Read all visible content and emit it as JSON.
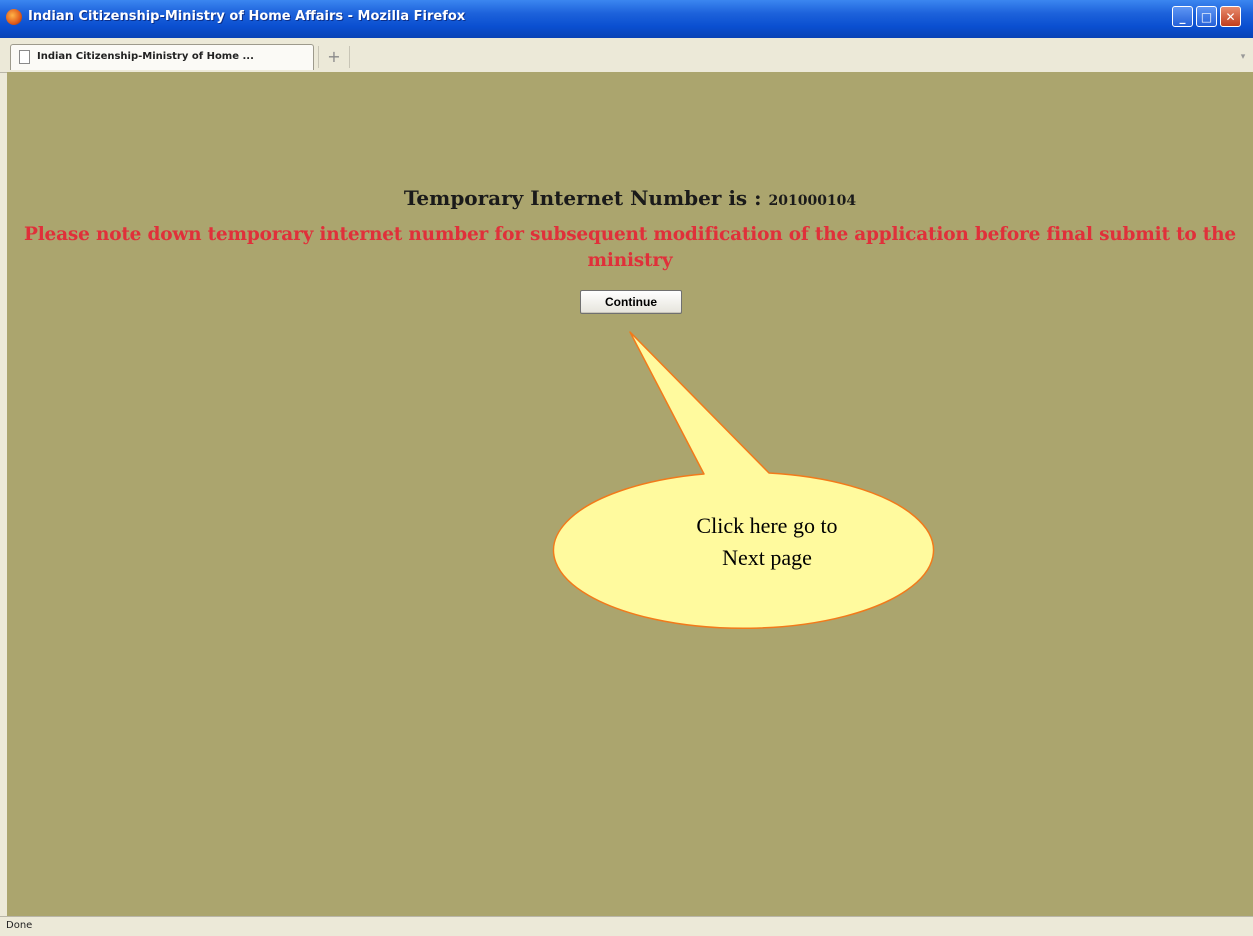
{
  "window": {
    "title": "Indian Citizenship-Ministry of Home Affairs - Mozilla Firefox",
    "min_symbol": "_",
    "max_symbol": "□",
    "close_symbol": "✕"
  },
  "tabs": {
    "active_label": "Indian Citizenship-Ministry of Home ...",
    "new_tab_symbol": "+",
    "scroll_symbol": "▾"
  },
  "page": {
    "temp_label": "Temporary Internet Number is : ",
    "temp_number": "201000104",
    "note": "Please note down temporary internet number for subsequent modification of the application before final submit to the ministry",
    "continue_label": "Continue",
    "background_color": "#aba56e",
    "note_color": "#e0303a"
  },
  "callout": {
    "line1": "Click here go to",
    "line2": "Next page",
    "fill_color": "#fffa9e",
    "border_color": "#f27a1a"
  },
  "status": {
    "text": "Done"
  }
}
